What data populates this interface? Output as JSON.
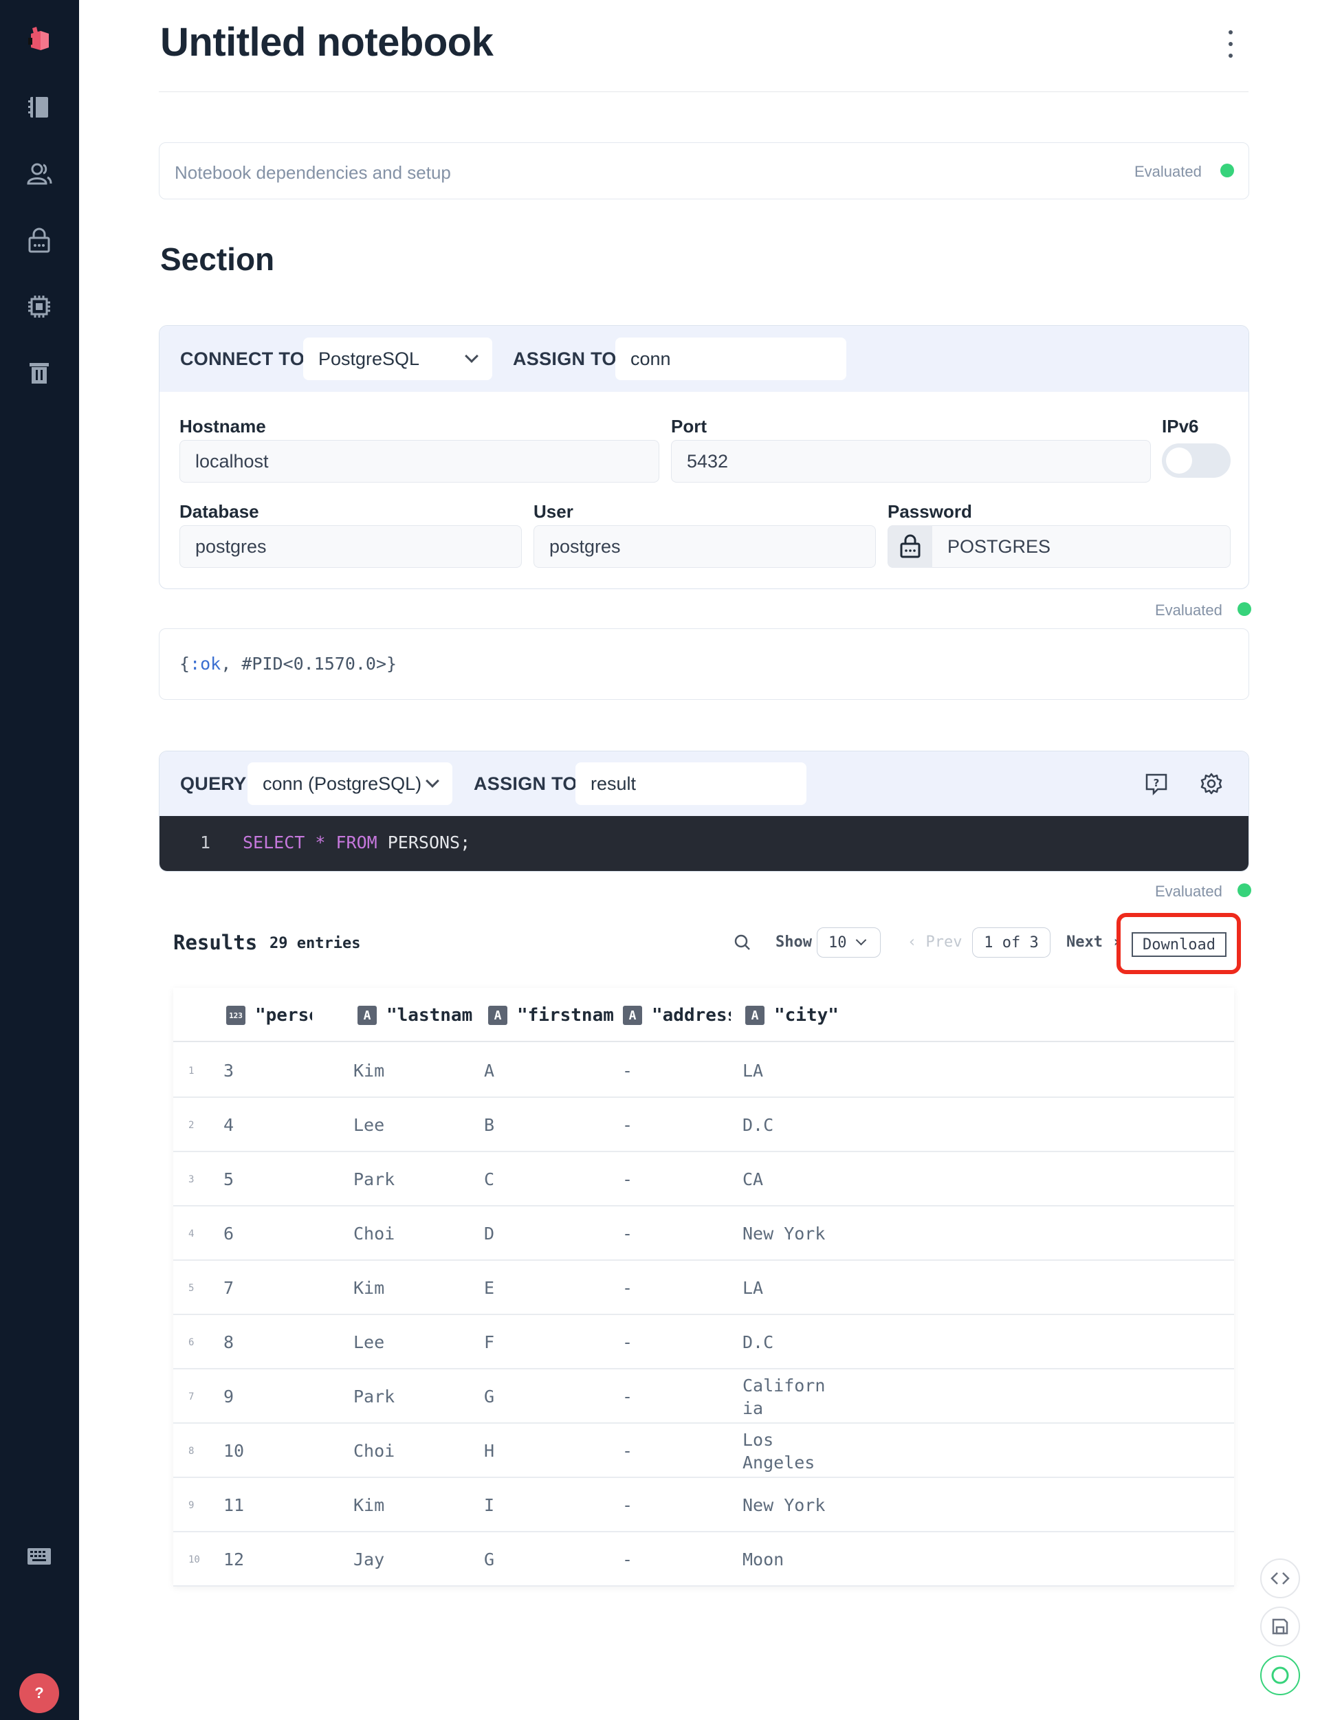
{
  "sidebar": {
    "icons": [
      "livebook-logo-icon",
      "notebook-icon",
      "users-icon",
      "secrets-icon",
      "runtime-chip-icon",
      "bin-icon",
      "keyboard-icon"
    ],
    "help_label": "?",
    "help_color": "#e0525b"
  },
  "notebook": {
    "title": "Untitled notebook",
    "setup_label": "Notebook dependencies and setup",
    "setup_status": "Evaluated",
    "section_title": "Section"
  },
  "connect_cell": {
    "connect_to_label": "CONNECT TO",
    "connection_type": "PostgreSQL",
    "assign_to_label": "ASSIGN TO",
    "assign_to_value": "conn",
    "hostname_label": "Hostname",
    "hostname_value": "localhost",
    "port_label": "Port",
    "port_value": "5432",
    "ipv6_label": "IPv6",
    "ipv6_enabled": false,
    "database_label": "Database",
    "database_value": "postgres",
    "user_label": "User",
    "user_value": "postgres",
    "password_label": "Password",
    "password_value": "POSTGRES",
    "status": "Evaluated",
    "output_kw": ":ok",
    "output_rest": ", #PID<0.1570.0>}",
    "output_open": "{"
  },
  "query_cell": {
    "query_label": "QUERY",
    "connection_value": "conn (PostgreSQL)",
    "assign_to_label": "ASSIGN TO",
    "assign_to_value": "result",
    "line_number": "1",
    "code_kw1": "SELECT",
    "code_star": " * ",
    "code_kw2": "FROM",
    "code_rest": " PERSONS;",
    "status": "Evaluated"
  },
  "results": {
    "title": "Results",
    "count": "29 entries",
    "show_label": "Show",
    "page_size": "10",
    "prev_label": "Prev",
    "page_indicator": "1 of 3",
    "next_label": "Next",
    "download_label": "Download",
    "highlight_color": "#ee2a1c",
    "columns": [
      {
        "type": "123",
        "name": "\"personi"
      },
      {
        "type": "A",
        "name": "\"lastnam"
      },
      {
        "type": "A",
        "name": "\"firstnam"
      },
      {
        "type": "A",
        "name": "\"address"
      },
      {
        "type": "A",
        "name": "\"city\""
      }
    ],
    "rows": [
      {
        "n": "1",
        "cells": [
          "3",
          "Kim",
          "A",
          "-",
          "LA"
        ]
      },
      {
        "n": "2",
        "cells": [
          "4",
          "Lee",
          "B",
          "-",
          "D.C"
        ]
      },
      {
        "n": "3",
        "cells": [
          "5",
          "Park",
          "C",
          "-",
          "CA"
        ]
      },
      {
        "n": "4",
        "cells": [
          "6",
          "Choi",
          "D",
          "-",
          "New York"
        ]
      },
      {
        "n": "5",
        "cells": [
          "7",
          "Kim",
          "E",
          "-",
          "LA"
        ]
      },
      {
        "n": "6",
        "cells": [
          "8",
          "Lee",
          "F",
          "-",
          "D.C"
        ]
      },
      {
        "n": "7",
        "cells": [
          "9",
          "Park",
          "G",
          "-",
          "Californ\nia"
        ]
      },
      {
        "n": "8",
        "cells": [
          "10",
          "Choi",
          "H",
          "-",
          "Los\nAngeles"
        ]
      },
      {
        "n": "9",
        "cells": [
          "11",
          "Kim",
          "I",
          "-",
          "New York"
        ]
      },
      {
        "n": "10",
        "cells": [
          "12",
          "Jay",
          "G",
          "-",
          "Moon"
        ]
      }
    ]
  }
}
